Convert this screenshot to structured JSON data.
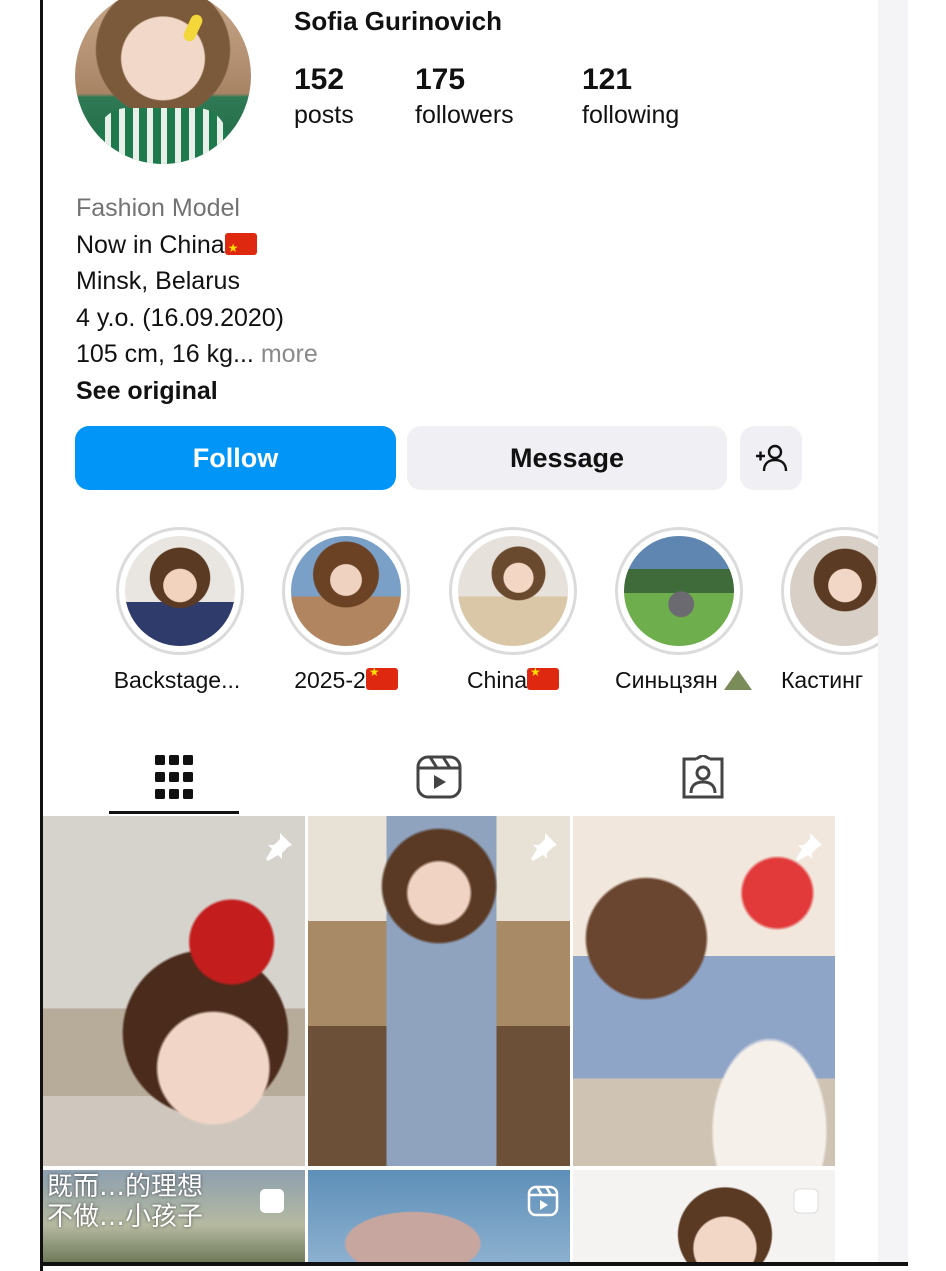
{
  "profile": {
    "username": "Sofia Gurinovich",
    "stats": [
      {
        "value": "152",
        "label": "posts"
      },
      {
        "value": "175",
        "label": "followers"
      },
      {
        "value": "121",
        "label": "following"
      }
    ],
    "bio": {
      "category": "Fashion Model",
      "line1": "Now in China",
      "line2": " Minsk, Belarus",
      "line3": " 4 y.o. (16.09.2020)",
      "line4": " 105 cm, 16 kg...",
      "more": " more",
      "see_original": "See original"
    }
  },
  "actions": {
    "follow": "Follow",
    "message": "Message",
    "add_user_icon": "add-person-icon"
  },
  "highlights": [
    {
      "label": "Backstage..."
    },
    {
      "label": "2025-2"
    },
    {
      "label": "China"
    },
    {
      "label": "Синьцзян"
    },
    {
      "label": "Кастинг"
    }
  ],
  "tabs": [
    {
      "icon": "grid-icon",
      "active": true
    },
    {
      "icon": "reels-icon",
      "active": false
    },
    {
      "icon": "tagged-icon",
      "active": false
    }
  ],
  "posts": [
    {
      "badge": "pin-icon"
    },
    {
      "badge": "pin-icon"
    },
    {
      "badge": "pin-icon"
    },
    {
      "badge": "carousel-icon",
      "overlay_line1": "既而…的理想",
      "overlay_line2": "不做…小孩子"
    },
    {
      "badge": "reels-icon"
    },
    {
      "badge": "carousel-icon"
    }
  ],
  "colors": {
    "follow_blue": "#0095f6",
    "secondary_button": "#efeff4",
    "muted_text": "#737373"
  }
}
